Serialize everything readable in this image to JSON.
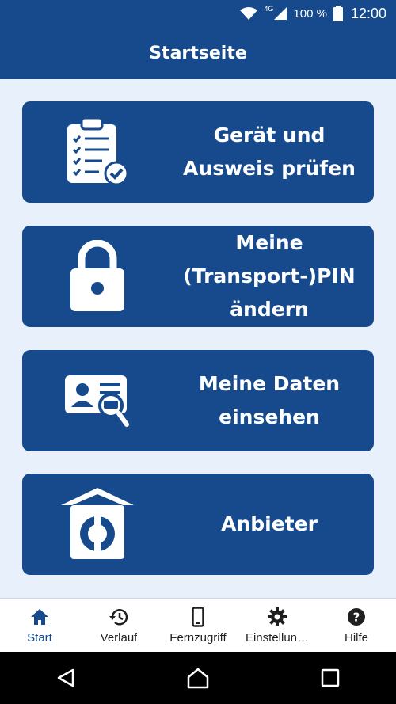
{
  "status_bar": {
    "wifi_icon": "wifi-icon",
    "network": "4G",
    "battery": "100 %",
    "clock": "12:00"
  },
  "header": {
    "title": "Startseite"
  },
  "cards": [
    {
      "label": "Gerät und\nAusweis prüfen",
      "icon": "checklist-icon"
    },
    {
      "label": "Meine\n(Transport-)PIN\nändern",
      "icon": "lock-icon"
    },
    {
      "label": "Meine Daten\neinsehen",
      "icon": "id-card-search-icon"
    },
    {
      "label": "Anbieter",
      "icon": "provider-house-icon"
    }
  ],
  "bottom_nav": {
    "active": "Start",
    "items": [
      {
        "label": "Start",
        "icon": "home-icon"
      },
      {
        "label": "Verlauf",
        "icon": "history-icon"
      },
      {
        "label": "Fernzugriff",
        "icon": "phone-icon"
      },
      {
        "label": "Einstellun…",
        "icon": "gear-icon"
      },
      {
        "label": "Hilfe",
        "icon": "help-icon"
      }
    ]
  },
  "colors": {
    "primary": "#164a8c",
    "background": "#e8f1fb",
    "nav_background": "#ffffff",
    "system_bar": "#000000"
  }
}
